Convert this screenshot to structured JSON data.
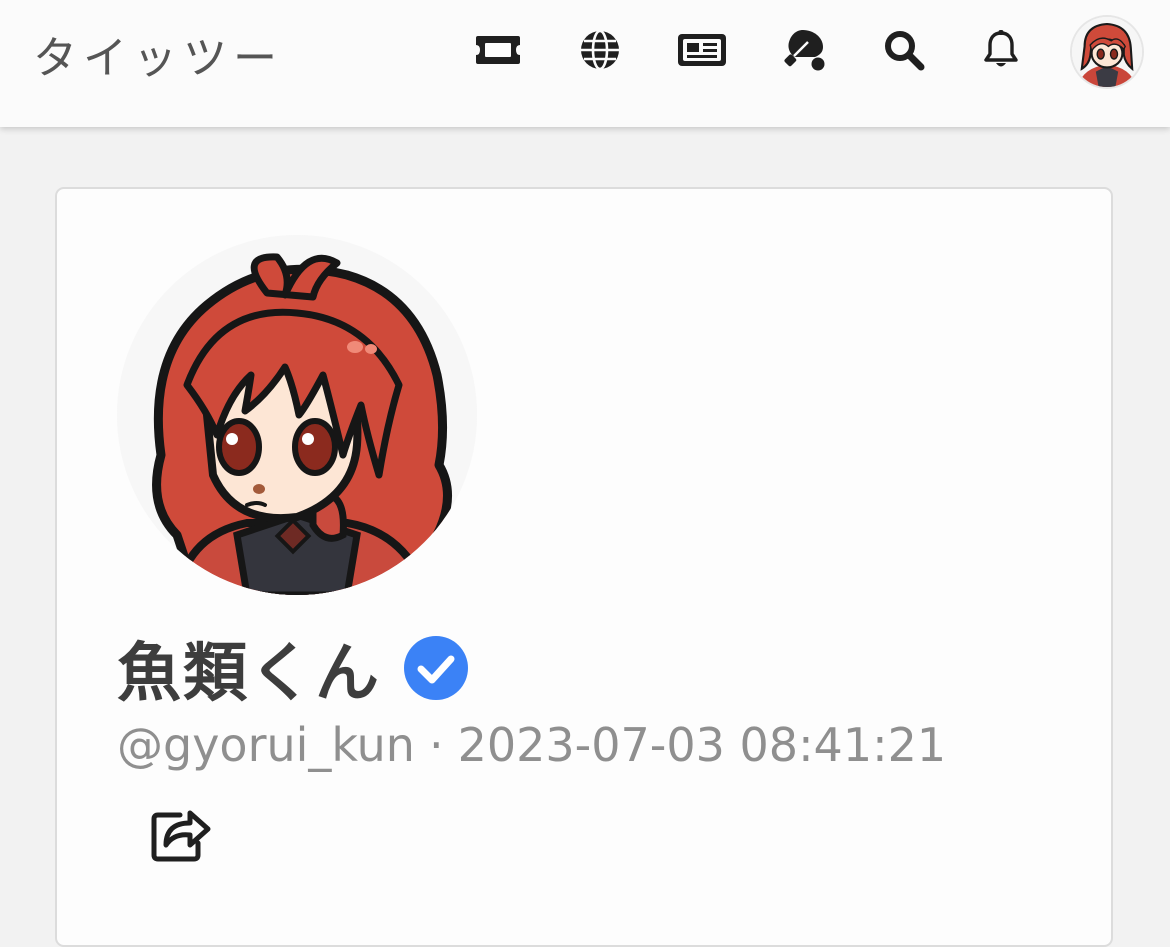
{
  "app": {
    "title": "タイッツー"
  },
  "nav": {
    "items": [
      {
        "icon": "ticket-icon"
      },
      {
        "icon": "globe-icon"
      },
      {
        "icon": "newspaper-icon"
      },
      {
        "icon": "table-tennis-icon"
      },
      {
        "icon": "search-icon"
      },
      {
        "icon": "bell-icon"
      }
    ]
  },
  "profile": {
    "display_name": "魚類くん",
    "handle": "@gyorui_kun",
    "separator": "·",
    "timestamp": "2023-07-03 08:41:21",
    "verified": true,
    "share_icon": "share-icon"
  },
  "colors": {
    "accent_verified": "#3b82f6",
    "hair": "#cf4a3a",
    "icon": "#1f1f1f"
  }
}
